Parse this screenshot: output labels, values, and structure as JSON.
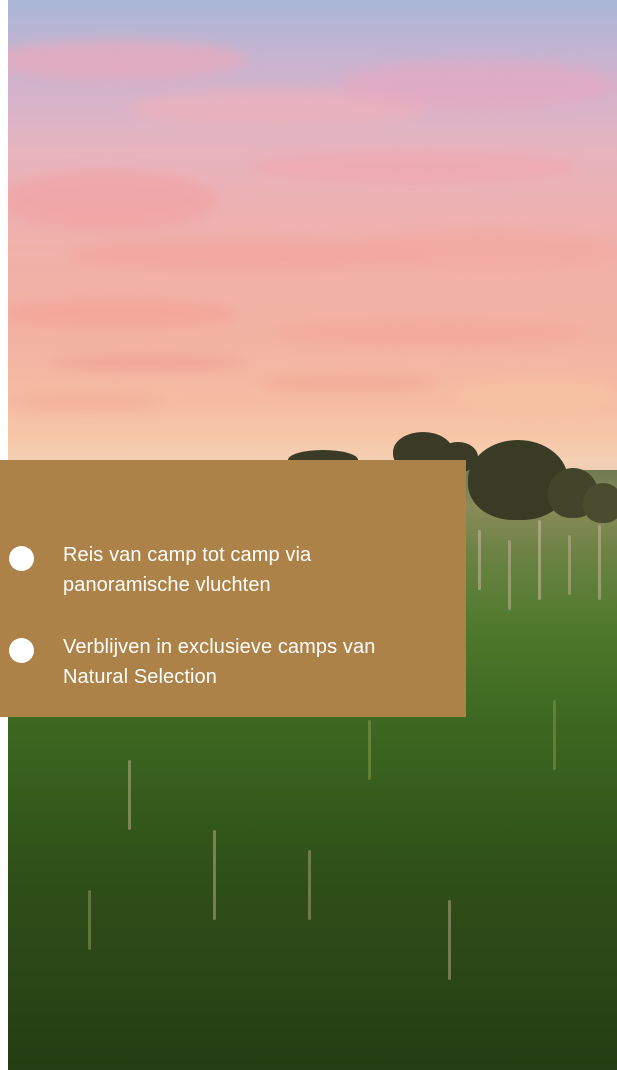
{
  "features": {
    "items": [
      {
        "line1": "Reis van camp tot camp via",
        "line2": "panoramische vluchten"
      },
      {
        "line1": "Verblijven in exclusieve camps van",
        "line2": "Natural Selection"
      }
    ]
  },
  "colors": {
    "card_background": "#ad8248",
    "text": "#ffffff",
    "bullet": "#ffffff"
  },
  "icons": {
    "bullet": "filled-circle-bullet-icon"
  }
}
